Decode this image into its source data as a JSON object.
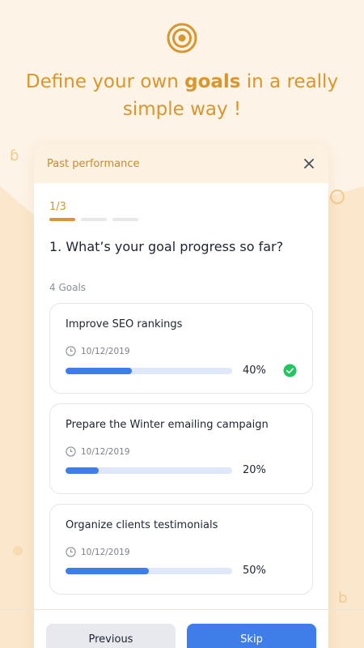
{
  "headline": {
    "prefix": "Define your own ",
    "emphasis": "goals",
    "suffix": " in a really simple way !"
  },
  "modal": {
    "title": "Past performance",
    "close_icon": "close-icon",
    "step": {
      "label": "1/3",
      "current": 1,
      "total": 3
    },
    "question": "1. What’s your goal progress so far?",
    "goals_count": "4 Goals",
    "goals": [
      {
        "title": "Improve SEO rankings",
        "date": "10/12/2019",
        "progress": 0.4,
        "percent_label": "40%",
        "completed_icon": true
      },
      {
        "title": "Prepare the Winter emailing campaign",
        "date": "10/12/2019",
        "progress": 0.2,
        "percent_label": "20%",
        "completed_icon": false
      },
      {
        "title": "Organize clients testimonials",
        "date": "10/12/2019",
        "progress": 0.5,
        "percent_label": "50%",
        "completed_icon": false
      }
    ],
    "buttons": {
      "previous": "Previous",
      "skip": "Skip"
    }
  },
  "colors": {
    "accent": "#d8962f",
    "primary": "#3f7de8",
    "success": "#22c55e",
    "background": "#fdf3e6"
  }
}
